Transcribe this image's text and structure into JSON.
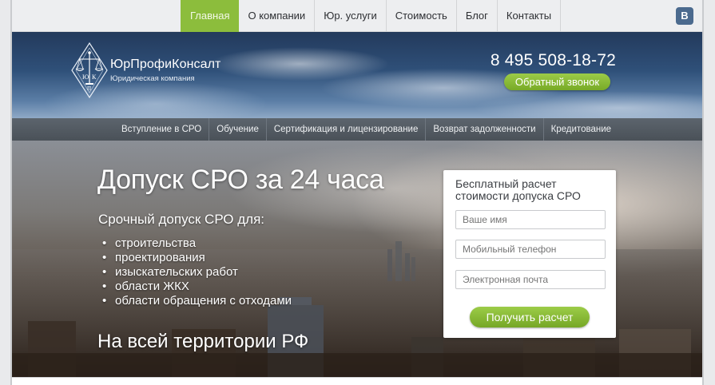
{
  "topnav": {
    "items": [
      "Главная",
      "О компании",
      "Юр. услуги",
      "Стоимость",
      "Блог",
      "Контакты"
    ],
    "active_index": 0,
    "social_label": "B"
  },
  "header": {
    "brand_name": "ЮрПрофиКонсалт",
    "brand_sub": "Юридическая компания",
    "phone": "8 495 508-18-72",
    "callback_label": "Обратный звонок"
  },
  "subnav": {
    "items": [
      "Вступление в СРО",
      "Обучение",
      "Сертификация и лицензирование",
      "Возврат задолженности",
      "Кредитование"
    ]
  },
  "hero": {
    "title": "Допуск СРО за 24 часа",
    "subtitle": "Срочный допуск СРО для:",
    "list": [
      "строительства",
      "проектирования",
      "изыскательских работ",
      "области ЖКХ",
      "области обращения с отходами"
    ],
    "bottom": "На всей территории РФ"
  },
  "form": {
    "title_line1": "Бесплатный расчет",
    "title_line2": "стоимости допуска СРО",
    "name_placeholder": "Ваше имя",
    "phone_placeholder": "Мобильный телефон",
    "email_placeholder": "Электронная почта",
    "submit_label": "Получить расчет"
  },
  "colors": {
    "accent_green": "#8cbd3c",
    "subnav_bg": "#5c646d",
    "social_bg": "#4b6a8e"
  }
}
